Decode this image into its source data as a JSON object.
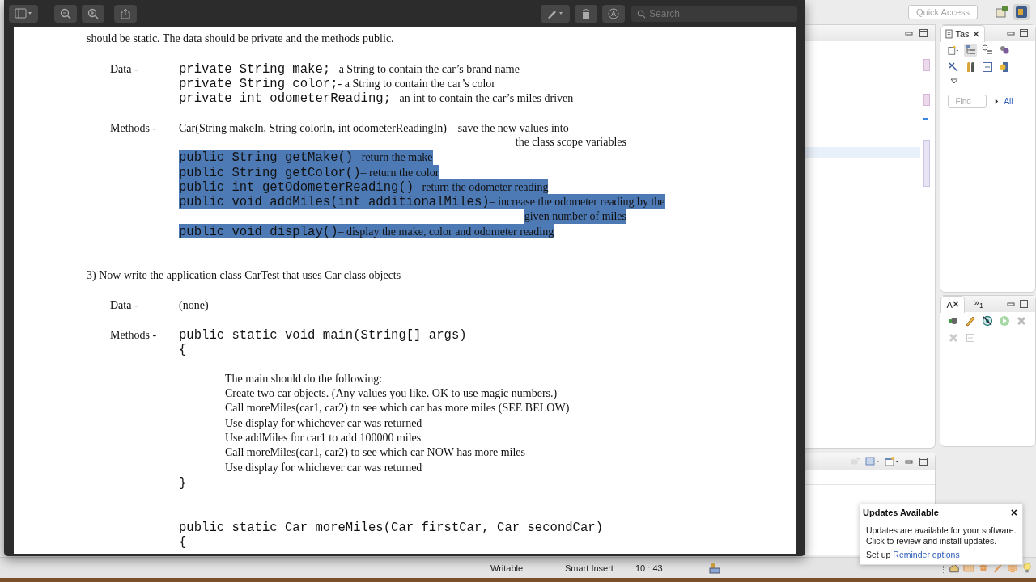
{
  "viewer": {
    "toolbar": {
      "search": {
        "placeholder": "Search"
      }
    },
    "document": {
      "sections": [
        {
          "blocks": [
            {
              "lines": [
                {
                  "kind": "para",
                  "text": "should be static. The data should be private and the methods public.",
                  "selected": false
                }
              ]
            },
            {
              "lines": [
                {
                  "kind": "row",
                  "label": "Data -",
                  "code": "private String make;",
                  "desc": "– a String to contain the car’s brand name",
                  "selected": false
                },
                {
                  "kind": "row",
                  "code": "private String color;",
                  "desc": "- a String to contain the car’s color",
                  "selected": false
                },
                {
                  "kind": "row",
                  "code": "private int odometerReading;",
                  "desc": "– an int to contain the car’s miles driven",
                  "selected": false
                }
              ]
            },
            {
              "lines": [
                {
                  "kind": "row",
                  "label": "Methods -",
                  "desc": "Car(String makeIn, String colorIn, int odometerReadingIn) – save the new values into",
                  "selected": false
                },
                {
                  "kind": "cont",
                  "text": "the class scope variables",
                  "selected": false
                },
                {
                  "kind": "row",
                  "code": "public String getMake()",
                  "desc": "– return the make",
                  "selected": true
                },
                {
                  "kind": "row",
                  "code": "public String getColor()",
                  "desc": "– return the color",
                  "selected": true
                },
                {
                  "kind": "row",
                  "code": "public int getOdometerReading()",
                  "desc": "– return the odometer reading",
                  "selected": true
                },
                {
                  "kind": "row",
                  "code": "public void addMiles(int additionalMiles)",
                  "desc": "– increase the odometer reading by the",
                  "selected": true
                },
                {
                  "kind": "cont",
                  "text": "given number of miles",
                  "selected": true
                },
                {
                  "kind": "row",
                  "code": "public void display()",
                  "desc": "– display the make, color and odometer reading",
                  "selected": true
                }
              ]
            }
          ]
        },
        {
          "blocks": [
            {
              "lines": [
                {
                  "kind": "para",
                  "text": "3) Now write the application class CarTest that uses Car class objects",
                  "selected": false
                }
              ]
            },
            {
              "lines": [
                {
                  "kind": "row",
                  "label": "Data -",
                  "desc": "(none)",
                  "selected": false
                }
              ]
            },
            {
              "lines": [
                {
                  "kind": "row",
                  "label": "Methods -",
                  "code": "public static void main(String[] args)",
                  "selected": false
                },
                {
                  "kind": "row",
                  "code": "{",
                  "selected": false
                }
              ]
            },
            {
              "lines": [
                {
                  "kind": "body",
                  "text": "The main should do the following:",
                  "selected": false
                },
                {
                  "kind": "body",
                  "text": "Create two car objects. (Any values you like.  OK to use magic numbers.)",
                  "selected": false
                },
                {
                  "kind": "body",
                  "text": "Call moreMiles(car1, car2) to see which car has more miles (SEE BELOW)",
                  "selected": false
                },
                {
                  "kind": "body",
                  "text": "Use display for whichever car was returned",
                  "selected": false
                },
                {
                  "kind": "body",
                  "text": "Use addMiles for car1 to add 100000 miles",
                  "selected": false
                },
                {
                  "kind": "body",
                  "text": "Call moreMiles(car1, car2) to see which car NOW has more miles",
                  "selected": false
                },
                {
                  "kind": "body",
                  "text": "Use display for whichever car was returned",
                  "selected": false
                },
                {
                  "kind": "row",
                  "code": "}",
                  "selected": false
                }
              ]
            }
          ]
        },
        {
          "blocks": [
            {
              "lines": [
                {
                  "kind": "row",
                  "code": "public static Car moreMiles(Car firstCar, Car secondCar)",
                  "selected": false
                },
                {
                  "kind": "row",
                  "code": "{",
                  "selected": false
                }
              ]
            }
          ]
        }
      ]
    }
  },
  "ide": {
    "quick_access": {
      "placeholder": "Quick Access"
    },
    "tasks_view": {
      "tab": "Tas",
      "find": {
        "placeholder": "Find"
      },
      "filter_link": "All"
    },
    "outline_view": {
      "tabs": [
        {
          "label": "A",
          "selected": true
        },
        {
          "label": "»$_{1}$",
          "selected": false
        }
      ]
    },
    "status_bar": [
      "Writable",
      "Smart Insert",
      "10 : 43"
    ]
  },
  "notification": {
    "title": "Updates Available",
    "close": "×",
    "body": [
      "Updates are available for your software.",
      "Click to review and install updates."
    ],
    "footer": "Set up",
    "link": "Reminder options"
  }
}
